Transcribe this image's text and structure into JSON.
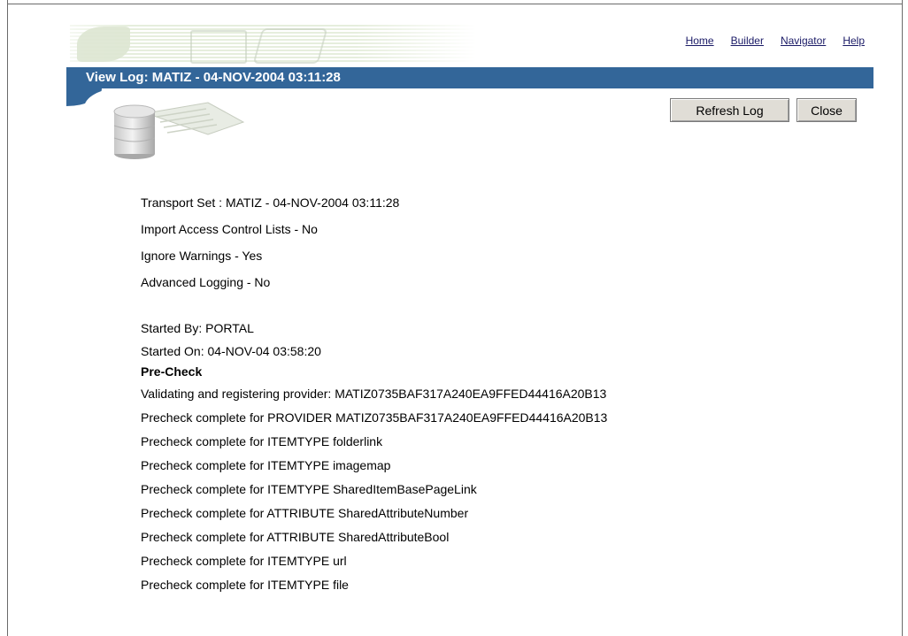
{
  "header": {
    "links": [
      "Home",
      "Builder",
      "Navigator",
      "Help"
    ],
    "title": "View Log: MATIZ - 04-NOV-2004 03:11:28"
  },
  "toolbar": {
    "refresh_label": "Refresh Log",
    "close_label": "Close"
  },
  "log": {
    "settings": [
      "Transport Set : MATIZ - 04-NOV-2004 03:11:28",
      "Import Access Control Lists - No",
      "Ignore Warnings - Yes",
      "Advanced Logging - No"
    ],
    "started_by": "Started By: PORTAL",
    "started_on": "Started On: 04-NOV-04 03:58:20",
    "section_title": "Pre-Check",
    "entries": [
      "Validating and registering provider: MATIZ0735BAF317A240EA9FFED44416A20B13",
      "Precheck complete for PROVIDER MATIZ0735BAF317A240EA9FFED44416A20B13",
      "Precheck complete for ITEMTYPE folderlink",
      "Precheck complete for ITEMTYPE imagemap",
      "Precheck complete for ITEMTYPE SharedItemBasePageLink",
      "Precheck complete for ATTRIBUTE SharedAttributeNumber",
      "Precheck complete for ATTRIBUTE SharedAttributeBool",
      "Precheck complete for ITEMTYPE url",
      "Precheck complete for ITEMTYPE file"
    ]
  },
  "colors": {
    "title_bar": "#336699",
    "link": "#1a1a66",
    "button_face": "#e0ddd6"
  }
}
